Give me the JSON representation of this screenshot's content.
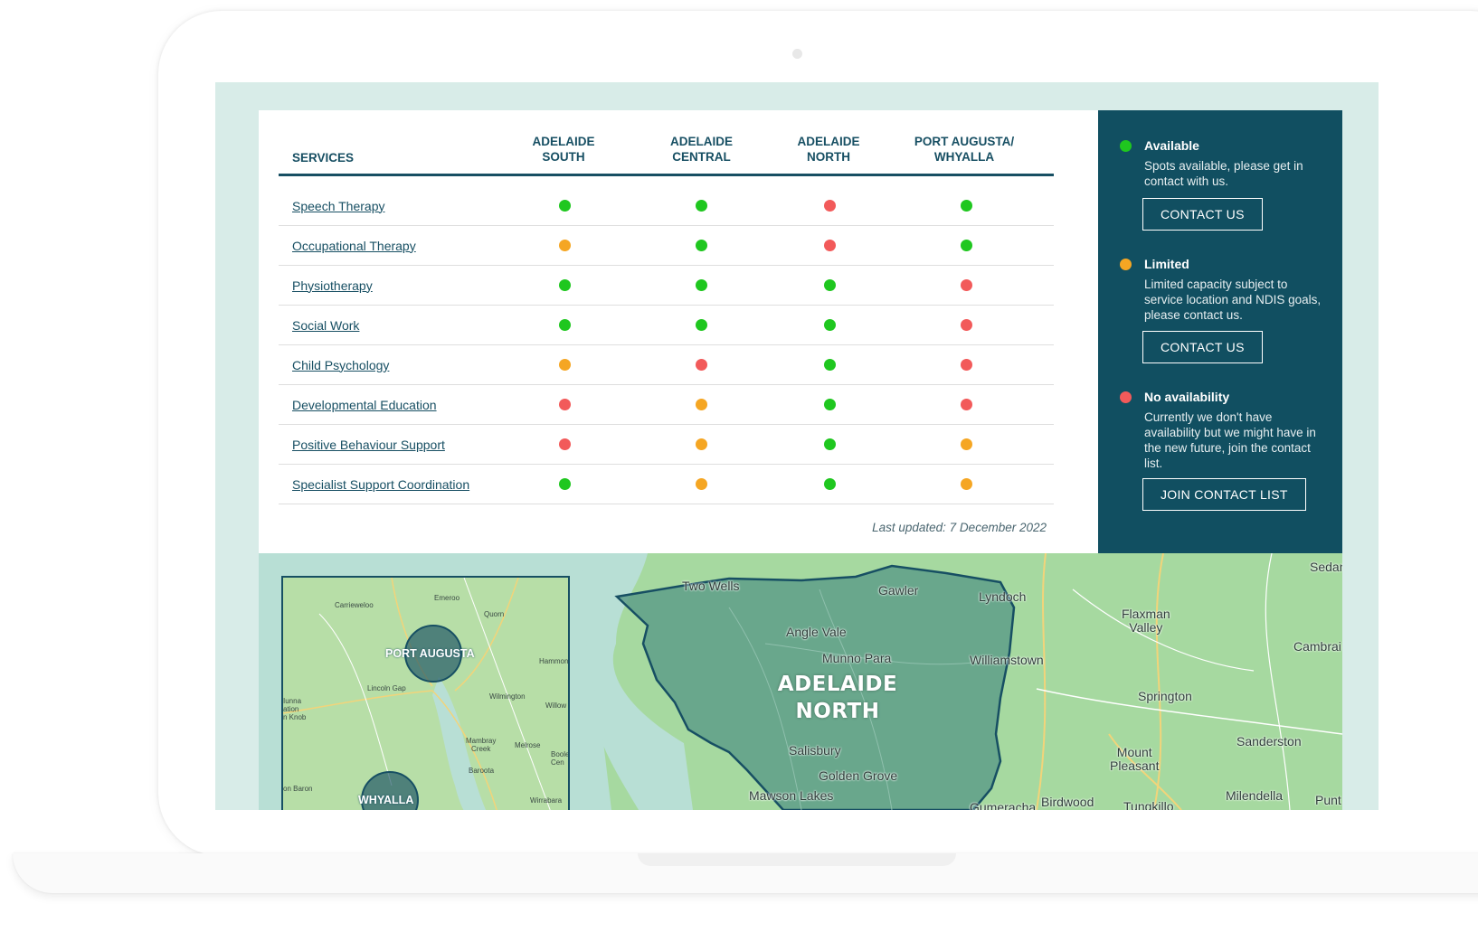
{
  "table": {
    "header": {
      "services": "SERVICES",
      "columns": [
        "ADELAIDE\nSOUTH",
        "ADELAIDE\nCENTRAL",
        "ADELAIDE\nNORTH",
        "PORT AUGUSTA/\nWHYALLA"
      ]
    },
    "rows": [
      {
        "service": "Speech Therapy",
        "status": [
          "available",
          "available",
          "none",
          "available"
        ]
      },
      {
        "service": "Occupational Therapy",
        "status": [
          "limited",
          "available",
          "none",
          "available"
        ]
      },
      {
        "service": "Physiotherapy",
        "status": [
          "available",
          "available",
          "available",
          "none"
        ]
      },
      {
        "service": "Social Work",
        "status": [
          "available",
          "available",
          "available",
          "none"
        ]
      },
      {
        "service": "Child Psychology",
        "status": [
          "limited",
          "none",
          "available",
          "none"
        ]
      },
      {
        "service": "Developmental Education",
        "status": [
          "none",
          "limited",
          "available",
          "none"
        ]
      },
      {
        "service": "Positive Behaviour Support",
        "status": [
          "none",
          "limited",
          "available",
          "limited"
        ]
      },
      {
        "service": "Specialist Support Coordination",
        "status": [
          "available",
          "limited",
          "available",
          "limited"
        ]
      }
    ],
    "last_updated": "Last updated: 7 December 2022"
  },
  "status_colors": {
    "available": "#1fc71f",
    "limited": "#f5a623",
    "none": "#f25a5a"
  },
  "legend": {
    "available": {
      "title": "Available",
      "desc": "Spots available, please get in contact with us.",
      "button": "CONTACT US"
    },
    "limited": {
      "title": "Limited",
      "desc": "Limited capacity subject to service location and NDIS goals, please contact us.",
      "button": "CONTACT US"
    },
    "none": {
      "title": "No availability",
      "desc": "Currently we don't have availability but we might have in the new future, join the contact list.",
      "button": "JOIN CONTACT LIST"
    }
  },
  "map": {
    "region": "ADELAIDE\nNORTH",
    "places": [
      "Two Wells",
      "Gawler",
      "Lyndoch",
      "Angle Vale",
      "Munno Para",
      "Williamstown",
      "Salisbury",
      "Golden Grove",
      "Mawson Lakes",
      "Gumeracha",
      "Birdwood",
      "Tungkillo",
      "Flaxman\nValley",
      "Springton",
      "Mount\nPleasant",
      "Sanderston",
      "Milendella",
      "Cambrai",
      "Sedan",
      "Punt"
    ],
    "inset": {
      "cities": [
        "PORT AUGUSTA",
        "WHYALLA"
      ],
      "places": [
        "Carrieweloo",
        "Emeroo",
        "Quorn",
        "Hammond",
        "Lincoln Gap",
        "Wilmington",
        "Willow",
        "Iunna\nation\nn Knob",
        "Mambray\nCreek",
        "Melrose",
        "Boole\nCen",
        "Baroota",
        "on Baron",
        "Wirrabara"
      ]
    }
  }
}
